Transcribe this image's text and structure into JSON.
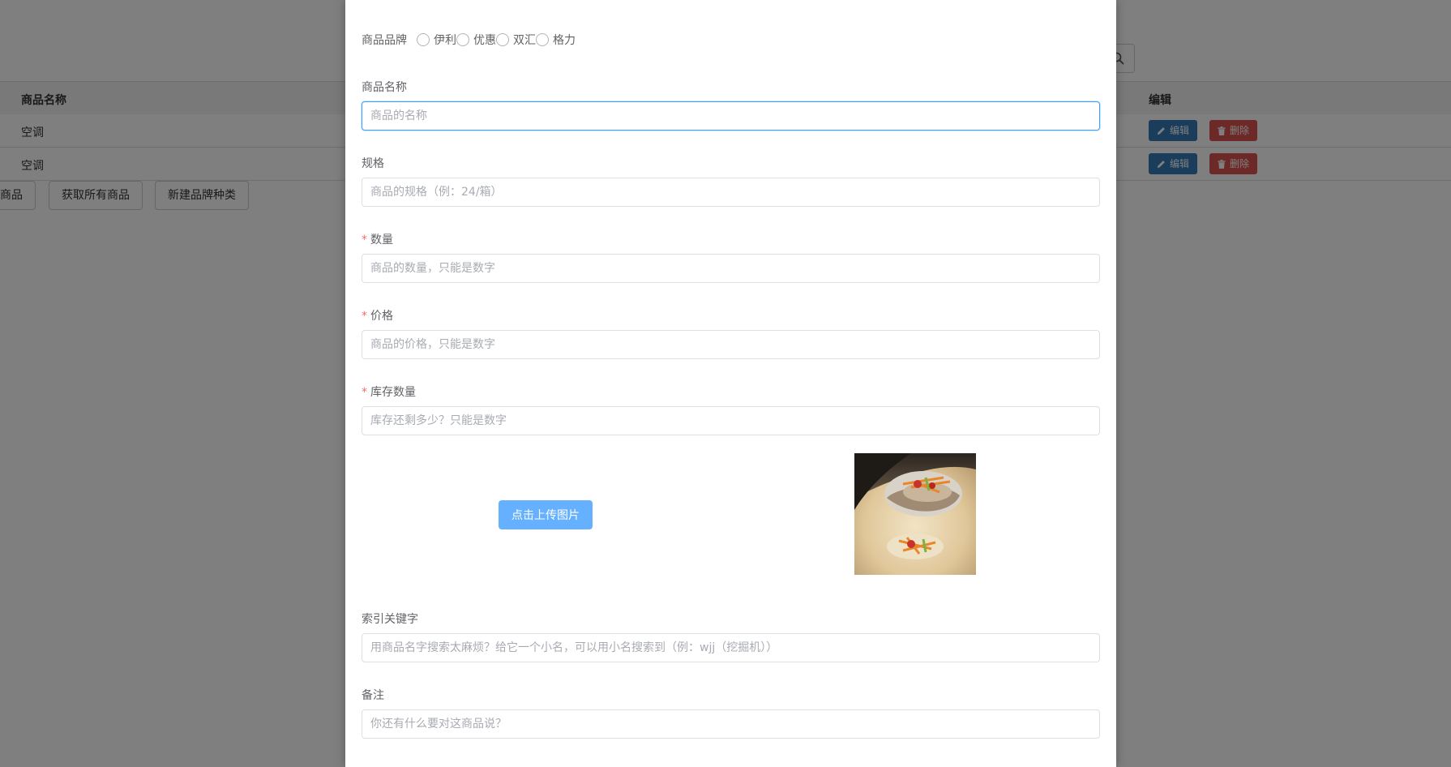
{
  "background": {
    "table": {
      "headers": {
        "name": "商品名称",
        "edit": "编辑"
      },
      "rows": [
        {
          "name": "空调",
          "edit_label": "编辑",
          "delete_label": "删除"
        },
        {
          "name": "空调",
          "edit_label": "编辑",
          "delete_label": "删除"
        }
      ]
    },
    "buttons": {
      "partial": "商品",
      "get_all": "获取所有商品",
      "new_brand": "新建品牌种类"
    }
  },
  "modal": {
    "brand": {
      "label": "商品品牌",
      "options": [
        "伊利",
        "优惠",
        "双汇",
        "格力"
      ]
    },
    "fields": {
      "name": {
        "label": "商品名称",
        "placeholder": "商品的名称",
        "required": false
      },
      "spec": {
        "label": "规格",
        "placeholder": "商品的规格（例：24/箱）",
        "required": false
      },
      "quantity": {
        "label": "数量",
        "placeholder": "商品的数量，只能是数字",
        "required": true
      },
      "price": {
        "label": "价格",
        "placeholder": "商品的价格，只能是数字",
        "required": true
      },
      "stock": {
        "label": "库存数量",
        "placeholder": "库存还剩多少？只能是数字",
        "required": true
      },
      "keywords": {
        "label": "索引关键字",
        "placeholder": "用商品名字搜索太麻烦？给它一个小名，可以用小名搜索到（例：wjj（挖掘机））",
        "required": false
      },
      "remark": {
        "label": "备注",
        "placeholder": "你还有什么要对这商品说？",
        "required": false
      }
    },
    "upload": {
      "button_label": "点击上传图片"
    },
    "required_mark": "*"
  },
  "colors": {
    "primary": "#409eff",
    "upload_button": "#66b1ff",
    "required": "#f56c6c",
    "edit_button": "#337ab7",
    "delete_button": "#d9534f"
  },
  "icons": {
    "search": "search-icon",
    "edit": "pencil-icon",
    "delete": "trash-icon"
  }
}
